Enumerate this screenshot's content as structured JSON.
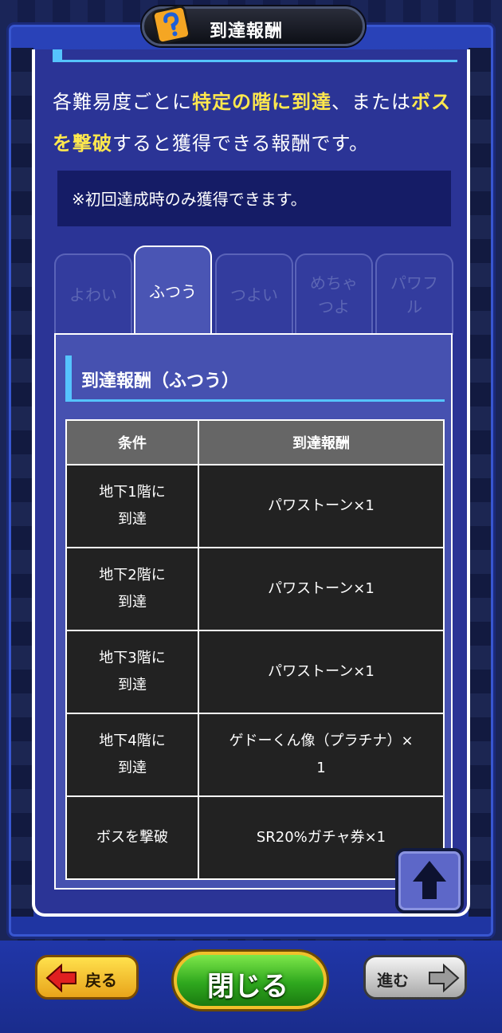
{
  "header": {
    "title": "到達報酬",
    "help_icon": "question-mark-icon"
  },
  "intro": {
    "part1": "各難易度ごとに",
    "highlight1": "特定の階に到達",
    "part2": "、または",
    "highlight2": "ボスを撃破",
    "part3": "すると獲得できる報酬です。"
  },
  "note": "※初回達成時のみ獲得できます。",
  "tabs": [
    {
      "label": "よわい",
      "active": false
    },
    {
      "label": "ふつう",
      "active": true
    },
    {
      "label": "つよい",
      "active": false
    },
    {
      "label": "めちゃ\nつよ",
      "active": false
    },
    {
      "label": "パワフ\nル",
      "active": false
    }
  ],
  "section": {
    "title": "到達報酬（ふつう）"
  },
  "table": {
    "headers": [
      "条件",
      "到達報酬"
    ],
    "rows": [
      {
        "condition": "地下1階に\n到達",
        "reward": "パワストーン×1"
      },
      {
        "condition": "地下2階に\n到達",
        "reward": "パワストーン×1"
      },
      {
        "condition": "地下3階に\n到達",
        "reward": "パワストーン×1"
      },
      {
        "condition": "地下4階に\n到達",
        "reward": "ゲドーくん像（プラチナ）×\n1"
      },
      {
        "condition": "ボスを撃破",
        "reward": "SR20%ガチャ券×1"
      }
    ]
  },
  "footer": {
    "back_label": "戻る",
    "close_label": "閉じる",
    "forward_label": "進む"
  },
  "colors": {
    "panel": "#2b3496",
    "highlight": "#ffe84d",
    "accent": "#55c4ff",
    "table_header": "#666666",
    "table_cell": "#222222"
  }
}
